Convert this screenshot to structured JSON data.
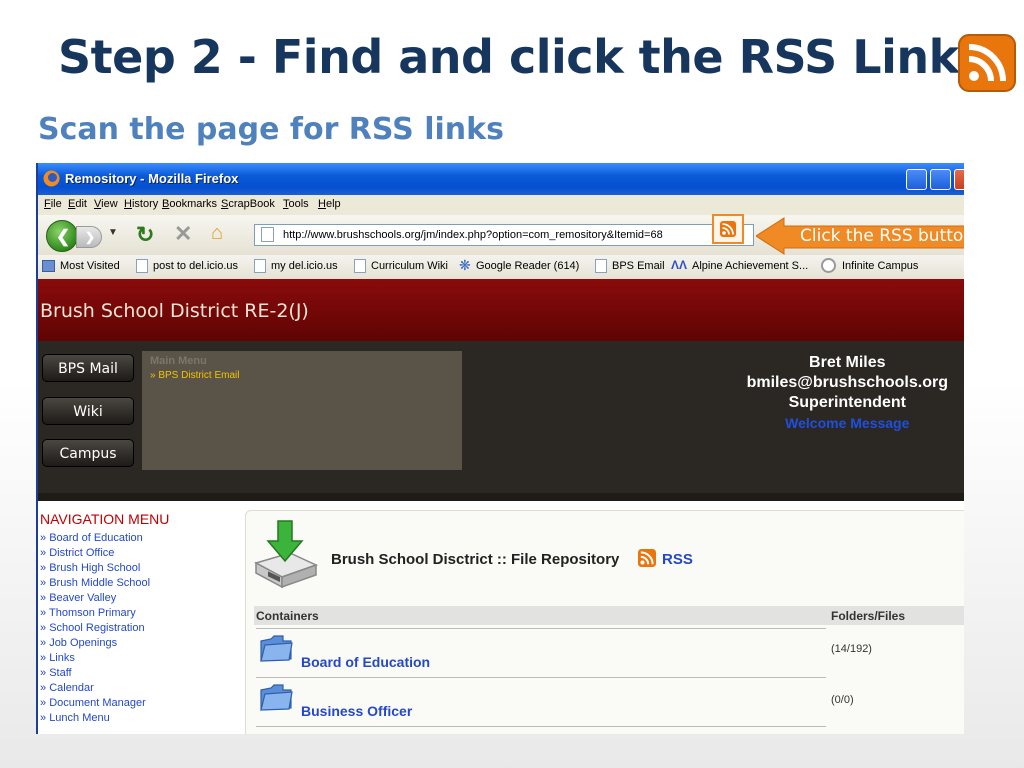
{
  "slide": {
    "title": "Step 2 - Find and click the RSS Link",
    "subtitle": "Scan the page for RSS links",
    "icon": "rss-feed-icon"
  },
  "browser": {
    "window_title": "Remository - Mozilla Firefox",
    "menu": [
      "File",
      "Edit",
      "View",
      "History",
      "Bookmarks",
      "ScrapBook",
      "Tools",
      "Help"
    ],
    "url": "http://www.brushschools.org/jm/index.php?option=com_remository&Itemid=68",
    "callout": "Click the RSS button",
    "bookmarks": [
      "Most Visited",
      "post to del.icio.us",
      "my del.icio.us",
      "Curriculum Wiki",
      "Google Reader (614)",
      "BPS Email",
      "Alpine Achievement S...",
      "Infinite Campus"
    ],
    "accent": "#f08a24"
  },
  "site": {
    "title": "Brush School District RE-2(J)",
    "buttons": [
      "BPS Mail",
      "Wiki",
      "Campus"
    ],
    "main_menu_title": "Main Menu",
    "main_menu_item": "» BPS District Email",
    "contact": {
      "name": "Bret Miles",
      "email": "bmiles@brushschools.org",
      "role": "Superintendent",
      "link": "Welcome Message"
    },
    "nav_title": "NAVIGATION MENU",
    "nav_links": [
      "Board of Education",
      "District Office",
      "Brush High School",
      "Brush Middle School",
      "Beaver Valley",
      "Thomson Primary",
      "School Registration",
      "Job Openings",
      "Links",
      "Staff",
      "Calendar",
      "Document Manager",
      "Lunch Menu"
    ],
    "repository_title": "Brush School Disctrict :: File Repository",
    "rss_link": "RSS",
    "columns": [
      "Containers",
      "Folders/Files"
    ],
    "rows": [
      {
        "name": "Board of Education",
        "count": "(14/192)"
      },
      {
        "name": "Business Officer",
        "count": "(0/0)"
      }
    ]
  }
}
